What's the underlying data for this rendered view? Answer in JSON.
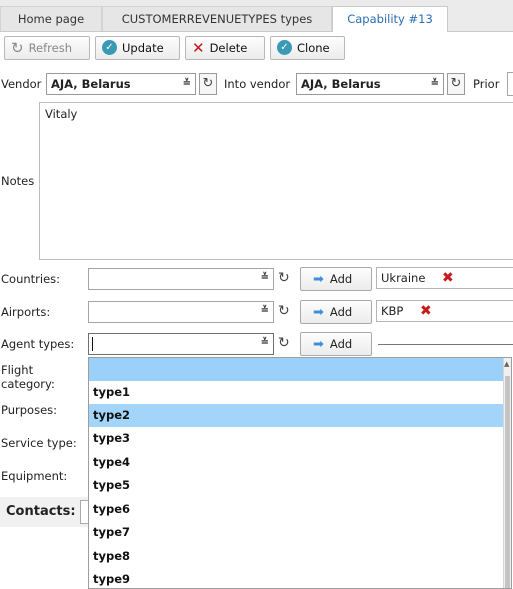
{
  "tabs": [
    {
      "label": "Home page",
      "active": false
    },
    {
      "label": "CUSTOMERREVENUETYPES types",
      "active": false
    },
    {
      "label": "Capability #13",
      "active": true
    }
  ],
  "toolbar": {
    "refresh": "Refresh",
    "update": "Update",
    "delete": "Delete",
    "clone": "Clone"
  },
  "vendor": {
    "label": "Vendor",
    "value": "AJA, Belarus"
  },
  "into_vendor": {
    "label": "Into vendor",
    "value": "AJA, Belarus"
  },
  "prior": {
    "label": "Prior"
  },
  "notes": {
    "label": "Notes",
    "value": "Vitaly"
  },
  "fields": {
    "countries": {
      "label": "Countries:",
      "add": "Add",
      "tag": "Ukraine"
    },
    "airports": {
      "label": "Airports:",
      "add": "Add",
      "tag": "KBP"
    },
    "agent_types": {
      "label": "Agent types:",
      "add": "Add"
    },
    "flight_category": {
      "label": "Flight category:"
    },
    "purposes": {
      "label": "Purposes:"
    },
    "service_type": {
      "label": "Service type:"
    },
    "equipment": {
      "label": "Equipment:"
    },
    "contacts": {
      "label": "Contacts:"
    }
  },
  "dropdown": {
    "options": [
      "",
      "type1",
      "type2",
      "type3",
      "type4",
      "type5",
      "type6",
      "type7",
      "type8",
      "type9"
    ],
    "highlighted": "type2"
  },
  "icons": {
    "refresh": "refresh-icon",
    "ok": "check-circle-icon",
    "delete": "x-icon",
    "expand": "double-chevron-down-icon",
    "add": "arrow-right-icon",
    "remove": "red-x-icon"
  },
  "colors": {
    "accent": "#2a6db0",
    "highlight": "#a3d4fa",
    "danger": "#c81a1a",
    "ok": "#3a9ab6"
  }
}
